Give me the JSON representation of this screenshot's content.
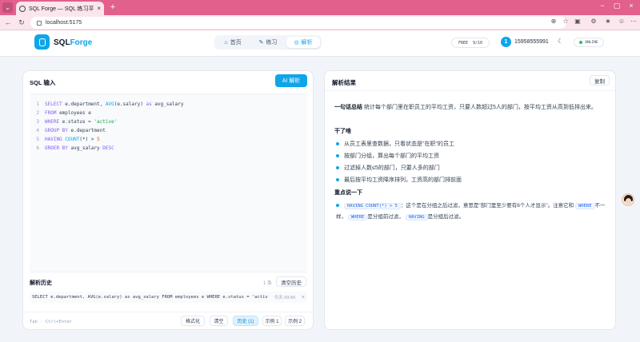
{
  "browser": {
    "tab_title": "SQL Forge — SQL 练习平台",
    "url": "localhost:5175"
  },
  "header": {
    "brand_prefix": "SQL",
    "brand_accent": "Forge",
    "nav": [
      {
        "label": "首页",
        "icon": "home-icon"
      },
      {
        "label": "练习",
        "icon": "pencil-icon"
      },
      {
        "label": "解析",
        "icon": "target-icon"
      }
    ],
    "free_label": "FREE",
    "free_count": "9/10",
    "avatar_initial": "1",
    "phone": "15958555991",
    "online_label": "ONLINE"
  },
  "left": {
    "title": "SQL 输入",
    "ai_button": "AI 解析",
    "code_lines": [
      {
        "n": "1",
        "text": "SELECT e.department, AVG(e.salary) as avg_salary"
      },
      {
        "n": "2",
        "text": "FROM employees e"
      },
      {
        "n": "3",
        "text": "WHERE e.status = 'active'"
      },
      {
        "n": "4",
        "text": "GROUP BY e.department"
      },
      {
        "n": "5",
        "text": "HAVING COUNT(*) > 5"
      },
      {
        "n": "6",
        "text": "ORDER BY avg_salary DESC"
      }
    ],
    "history_title": "解析历史",
    "history_count": "1 条",
    "clear_history": "清空历史",
    "history_items": [
      {
        "query": "SELECT e.department, AVG(e.salary) as avg_salary FROM employees e WHERE e.status = 'activ…",
        "time": "今天 09:49"
      }
    ],
    "hint": "Tab · Ctrl+Enter",
    "buttons": {
      "format": "格式化",
      "clear": "清空",
      "history": "历史 (1)",
      "example1": "示例 1",
      "example2": "示例 2"
    }
  },
  "right": {
    "title": "解析结果",
    "copy_button": "复制",
    "summary_label": "一句话总结",
    "summary_text": "统计每个部门里在职员工的平均工资，只要人数超过5人的部门，按平均工资从高到低排出来。",
    "section1": "干了啥",
    "steps": [
      "从员工表里查数据，只看状态是\"在职\"的员工",
      "按部门分组，算出每个部门的平均工资",
      "过滤掉人数≤5的部门，只要人多的部门",
      "最后按平均工资降序排列，工资高的部门排前面"
    ],
    "section2": "重点说一下",
    "note_chip1": "HAVING COUNT(*) > 5",
    "note_text1": "：这个是在分组之后过滤，意思是\"部门里至少要有6个人才显示\"。注意它和",
    "note_chip2": "WHERE",
    "note_text2": "不一样，",
    "note_chip3": "WHERE",
    "note_text3": "是分组前过滤，",
    "note_chip4": "HAVING",
    "note_text4": "是分组后过滤。"
  }
}
